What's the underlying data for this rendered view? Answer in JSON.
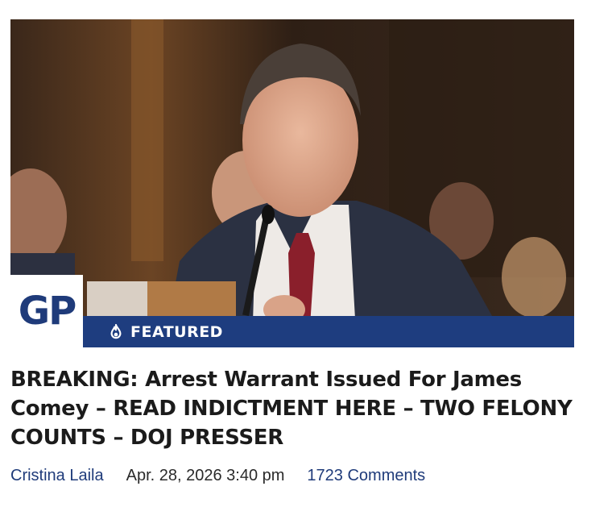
{
  "logo": {
    "text": "GP"
  },
  "badge": {
    "label": "FEATURED",
    "icon": "flame-icon"
  },
  "article": {
    "headline": "BREAKING: Arrest Warrant Issued For James Comey – READ INDICTMENT HERE – TWO FELONY COUNTS – DOJ PRESSER",
    "author": "Cristina Laila",
    "date": "Apr. 28, 2026 3:40 pm",
    "comments": "1723 Comments"
  },
  "colors": {
    "brand": "#1e3d7f",
    "text": "#1b1b1b",
    "link": "#1f3b7a"
  }
}
